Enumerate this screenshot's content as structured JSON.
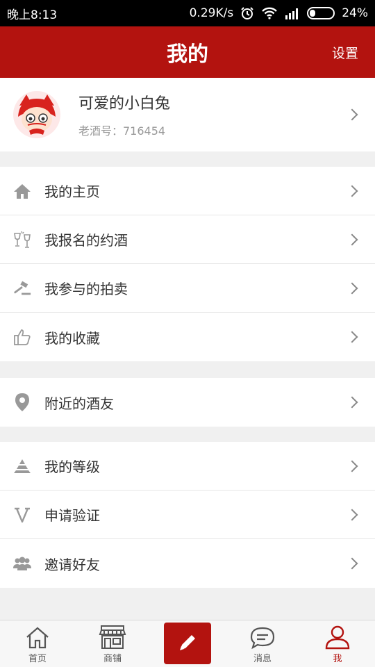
{
  "status": {
    "time": "晚上8:13",
    "net_speed": "0.29K/s",
    "battery": "24%",
    "battery_level": 0.24
  },
  "header": {
    "title": "我的",
    "settings": "设置"
  },
  "profile": {
    "name": "可爱的小白兔",
    "id_line": "老酒号：716454"
  },
  "menu": {
    "home": "我的主页",
    "signup": "我报名的约酒",
    "auction": "我参与的拍卖",
    "favorites": "我的收藏",
    "nearby": "附近的酒友",
    "level": "我的等级",
    "verify": "申请验证",
    "invite": "邀请好友"
  },
  "tabs": {
    "home": "首页",
    "shop": "商铺",
    "messages": "消息",
    "me": "我"
  },
  "colors": {
    "brand": "#b3130f",
    "icon_gray": "#999999"
  }
}
